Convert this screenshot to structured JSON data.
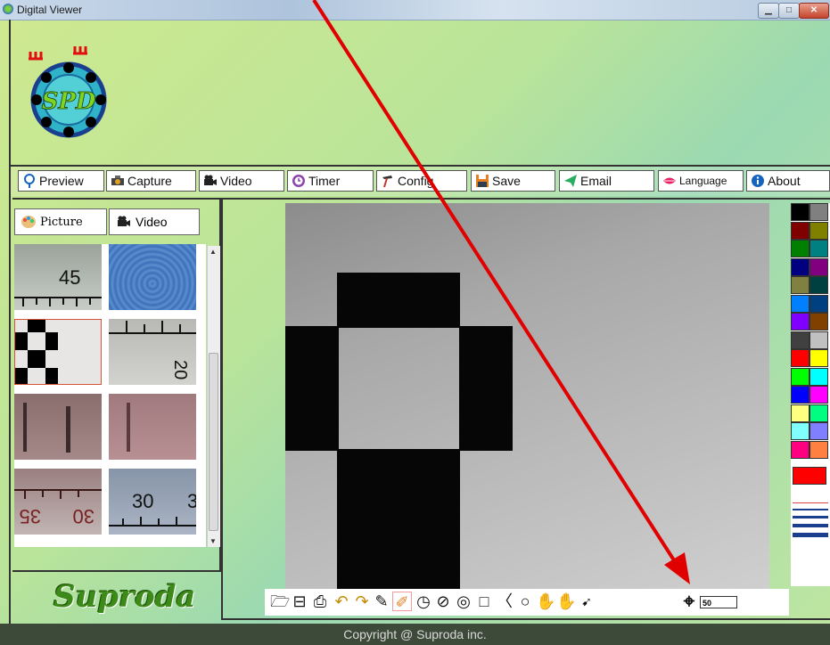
{
  "window": {
    "title": "Digital Viewer",
    "minimize_icon": "minimize-icon",
    "maximize_icon": "maximize-icon",
    "close_icon": "close-icon"
  },
  "logo": {
    "text": "SPD"
  },
  "toolbar": {
    "items": [
      {
        "label": "Preview",
        "icon": "magnifier-icon"
      },
      {
        "label": "Capture",
        "icon": "camera-icon"
      },
      {
        "label": "Video",
        "icon": "video-camera-icon"
      },
      {
        "label": "Timer",
        "icon": "clock-icon"
      },
      {
        "label": "Config",
        "icon": "hammer-icon"
      },
      {
        "label": "Save",
        "icon": "floppy-icon"
      },
      {
        "label": "Email",
        "icon": "paper-plane-icon"
      },
      {
        "label": "Language",
        "icon": "lips-icon"
      },
      {
        "label": "About",
        "icon": "info-icon"
      }
    ]
  },
  "gallery": {
    "tabs": [
      {
        "label": "Picture",
        "icon": "palette-icon"
      },
      {
        "label": "Video",
        "icon": "video-camera-icon"
      }
    ],
    "thumbnails": [
      {
        "label": "45",
        "kind": "ruler"
      },
      {
        "label": "",
        "kind": "blue-fabric"
      },
      {
        "label": "",
        "kind": "checkerboard",
        "selected": true
      },
      {
        "label": "20",
        "kind": "ruler-vertical"
      },
      {
        "label": "",
        "kind": "red-lines"
      },
      {
        "label": "",
        "kind": "red-lines-light"
      },
      {
        "label": "35",
        "label2": "30",
        "kind": "ruler-upside-down"
      },
      {
        "label": "30",
        "label2": "3",
        "kind": "ruler"
      }
    ]
  },
  "brand": {
    "text": "Suproda"
  },
  "palette": {
    "colors": [
      "#000000",
      "#808080",
      "#800000",
      "#808000",
      "#008000",
      "#008080",
      "#000080",
      "#800080",
      "#808040",
      "#004040",
      "#0080ff",
      "#004080",
      "#8000ff",
      "#804000",
      "#404040",
      "#c0c0c0",
      "#ff0000",
      "#ffff00",
      "#00ff00",
      "#00ffff",
      "#0000ff",
      "#ff00ff",
      "#ffff80",
      "#00ff80",
      "#80ffff",
      "#8080ff",
      "#ff0080",
      "#ff8040"
    ],
    "current_color": "#ff0000"
  },
  "drawtools": {
    "icons": [
      "open-icon",
      "save-list-icon",
      "print-icon",
      "undo-icon",
      "redo-icon",
      "edit-icon",
      "pencil-icon",
      "clock-circle-icon",
      "no-symbol-icon",
      "target-icon",
      "rectangle-icon",
      "angle-icon",
      "circle-icon",
      "hand-left-icon",
      "hand-right-icon",
      "pointer-icon",
      "crosshair-icon"
    ],
    "size_value": "50"
  },
  "footer": {
    "text": "Copyright @ Suproda inc."
  }
}
